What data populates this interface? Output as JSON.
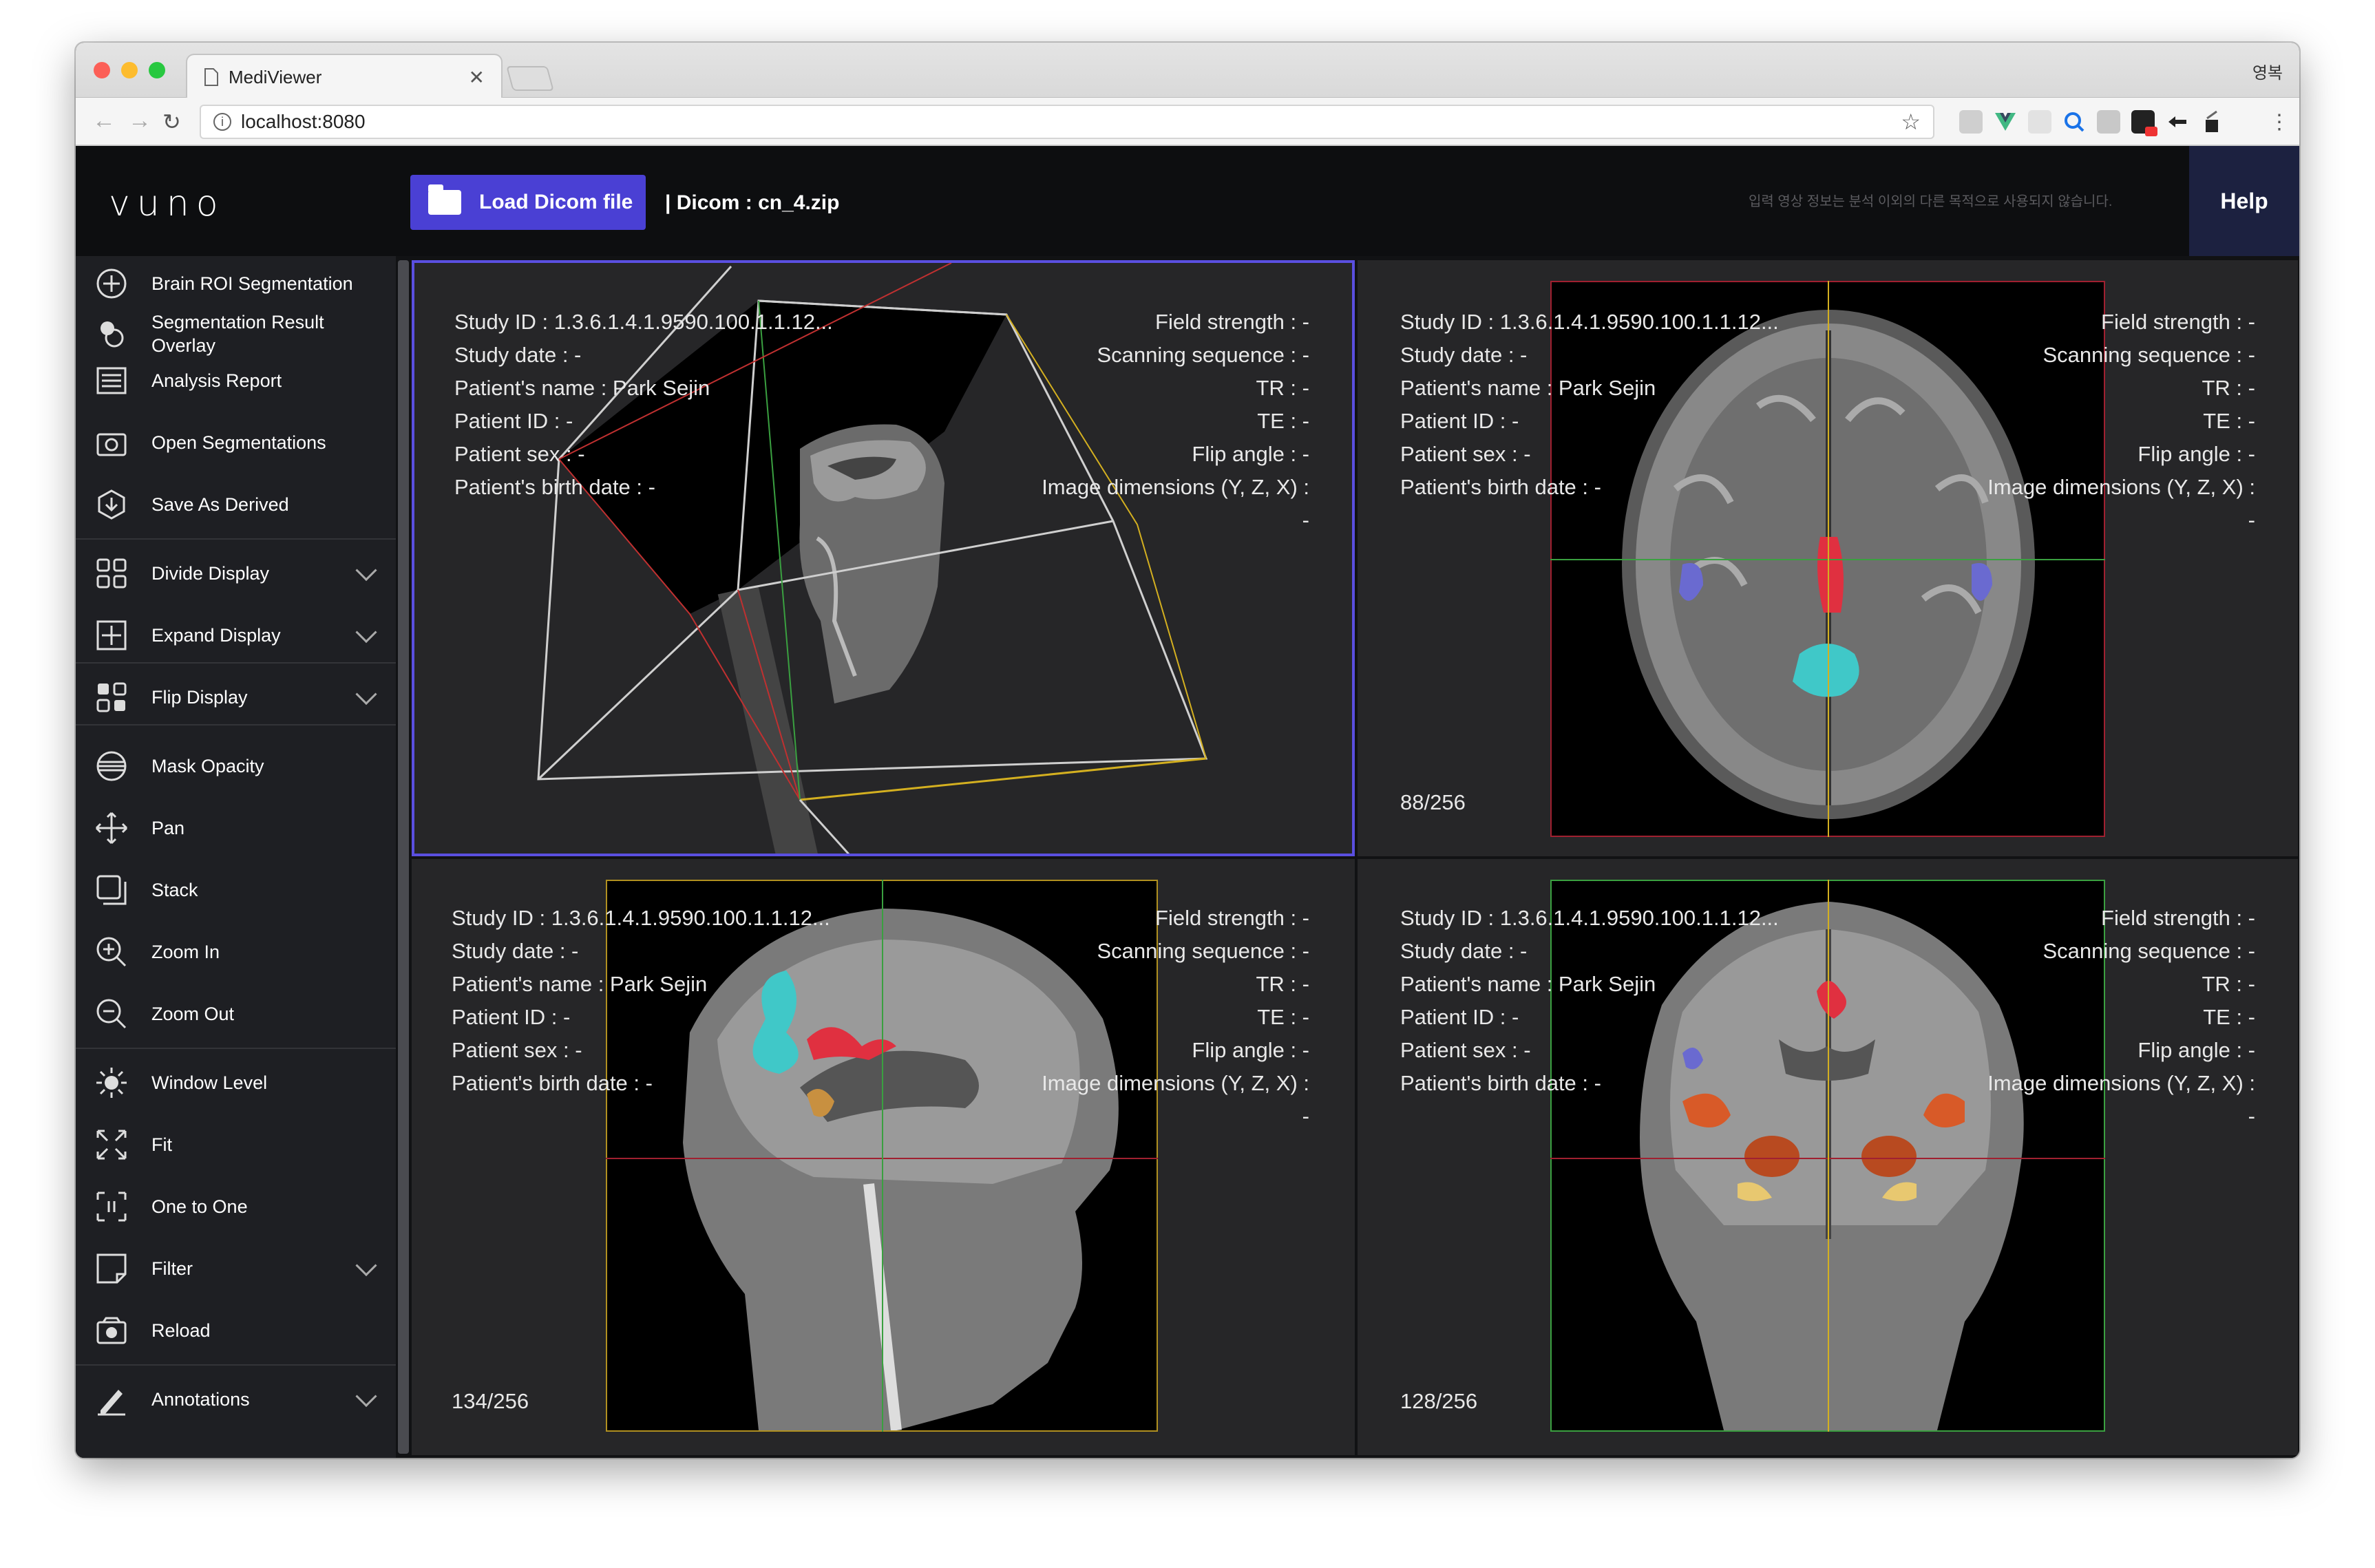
{
  "browser": {
    "tab_title": "MediViewer",
    "url": "localhost:8080",
    "profile": "영복"
  },
  "header": {
    "logo": "vuno",
    "load_button": "Load Dicom file",
    "dicom_label": "| Dicom : cn_4.zip",
    "notice": "입력 영상 정보는 분석 이외의 다른 목적으로 사용되지 않습니다.",
    "help": "Help"
  },
  "sidebar": {
    "items": [
      {
        "label": "Brain ROI Segmentation",
        "icon": "brain-roi-icon"
      },
      {
        "label": "Segmentation Result Overlay",
        "icon": "overlay-icon"
      },
      {
        "label": "Analysis Report",
        "icon": "report-icon"
      },
      {
        "label": "Open Segmentations",
        "icon": "camera-folder-icon"
      },
      {
        "label": "Save As Derived",
        "icon": "save-derived-icon"
      },
      {
        "label": "Divide Display",
        "icon": "grid-icon"
      },
      {
        "label": "Expand Display",
        "icon": "expand-icon"
      },
      {
        "label": "Flip Display",
        "icon": "flip-icon"
      },
      {
        "label": "Mask Opacity",
        "icon": "opacity-icon"
      },
      {
        "label": "Pan",
        "icon": "pan-icon"
      },
      {
        "label": "Stack",
        "icon": "stack-icon"
      },
      {
        "label": "Zoom In",
        "icon": "zoom-in-icon"
      },
      {
        "label": "Zoom Out",
        "icon": "zoom-out-icon"
      },
      {
        "label": "Window Level",
        "icon": "sun-icon"
      },
      {
        "label": "Fit",
        "icon": "fit-icon"
      },
      {
        "label": "One to One",
        "icon": "one-to-one-icon"
      },
      {
        "label": "Filter",
        "icon": "filter-icon"
      },
      {
        "label": "Reload",
        "icon": "reload-icon"
      },
      {
        "label": "Annotations",
        "icon": "pen-icon"
      }
    ]
  },
  "viewports": [
    {
      "left": [
        "Study ID : 1.3.6.1.4.1.9590.100.1.1.12...",
        "Study date : -",
        "Patient's name : Park Sejin",
        "Patient ID : -",
        "Patient sex : -",
        "Patient's birth date : -"
      ],
      "right": [
        "Field strength : -",
        "Scanning sequence : -",
        "TR : -",
        "TE : -",
        "Flip angle : -",
        "Image dimensions (Y, Z, X) :",
        "-"
      ],
      "slice": ""
    },
    {
      "left": [
        "Study ID : 1.3.6.1.4.1.9590.100.1.1.12...",
        "Study date : -",
        "Patient's name : Park Sejin",
        "Patient ID : -",
        "Patient sex : -",
        "Patient's birth date : -"
      ],
      "right": [
        "Field strength : -",
        "Scanning sequence : -",
        "TR : -",
        "TE : -",
        "Flip angle : -",
        "Image dimensions (Y, Z, X) :",
        "-"
      ],
      "slice": "88/256"
    },
    {
      "left": [
        "Study ID : 1.3.6.1.4.1.9590.100.1.1.12...",
        "Study date : -",
        "Patient's name : Park Sejin",
        "Patient ID : -",
        "Patient sex : -",
        "Patient's birth date : -"
      ],
      "right": [
        "Field strength : -",
        "Scanning sequence : -",
        "TR : -",
        "TE : -",
        "Flip angle : -",
        "Image dimensions (Y, Z, X) :",
        "-"
      ],
      "slice": "134/256"
    },
    {
      "left": [
        "Study ID : 1.3.6.1.4.1.9590.100.1.1.12...",
        "Study date : -",
        "Patient's name : Park Sejin",
        "Patient ID : -",
        "Patient sex : -",
        "Patient's birth date : -"
      ],
      "right": [
        "Field strength : -",
        "Scanning sequence : -",
        "TR : -",
        "TE : -",
        "Flip angle : -",
        "Image dimensions (Y, Z, X) :",
        "-"
      ],
      "slice": "128/256"
    }
  ],
  "colors": {
    "accent": "#4a40d4",
    "active_viewport_border": "#5a4fe0",
    "help_bg": "#1c2140",
    "seg_red": "#e03040",
    "seg_cyan": "#40c8c8",
    "seg_purple": "#6a6ad0",
    "seg_orange": "#d85a28",
    "seg_yellow": "#e8c870"
  }
}
